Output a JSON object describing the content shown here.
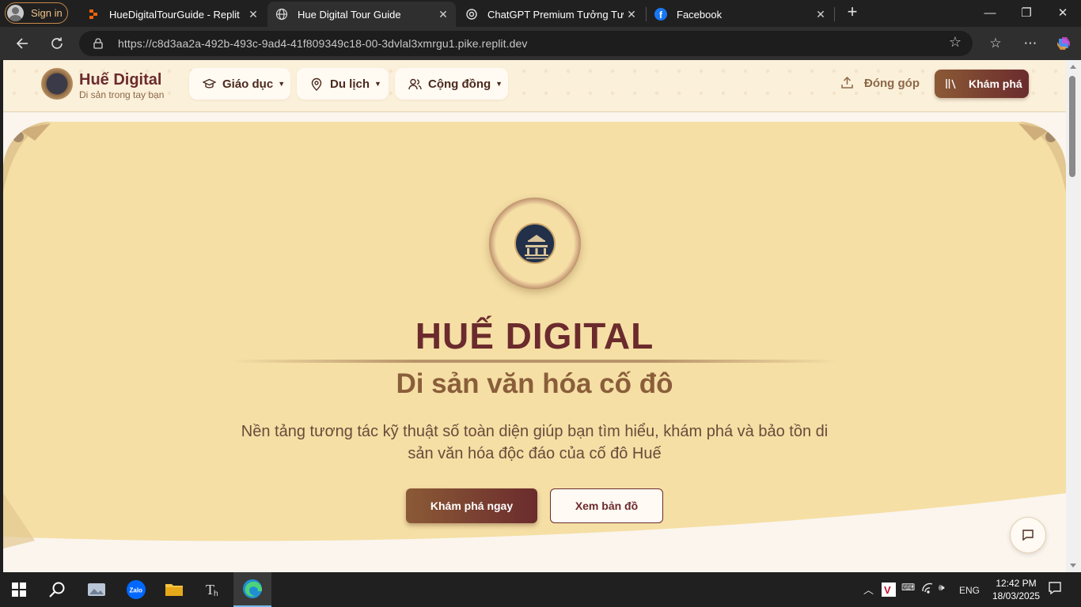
{
  "browser": {
    "signin_label": "Sign in",
    "tabs": [
      {
        "title": "HueDigitalTourGuide - Replit",
        "active": false
      },
      {
        "title": "Hue Digital Tour Guide",
        "active": true
      },
      {
        "title": "ChatGPT Premium Tưởng Tượng",
        "active": false
      },
      {
        "title": "Facebook",
        "active": false
      }
    ],
    "url": "https://c8d3aa2a-492b-493c-9ad4-41f809349c18-00-3dvlal3xmrgu1.pike.replit.dev"
  },
  "header": {
    "brand_title": "Huế Digital",
    "brand_subtitle": "Di sản trong tay bạn",
    "nav": [
      {
        "label": "Giáo dục",
        "icon": "graduation-cap-icon"
      },
      {
        "label": "Du lịch",
        "icon": "map-pin-icon"
      },
      {
        "label": "Cộng đồng",
        "icon": "users-icon"
      }
    ],
    "contribute_label": "Đóng góp",
    "explore_label": "Khám phá"
  },
  "hero": {
    "title": "HUẾ DIGITAL",
    "subtitle": "Di sản văn hóa cố đô",
    "description": "Nền tảng tương tác kỹ thuật số toàn diện giúp bạn tìm hiểu, khám phá và bảo tồn di sản văn hóa độc đáo của cố đô Huế",
    "primary_button": "Khám phá ngay",
    "secondary_button": "Xem bản đồ"
  },
  "taskbar": {
    "language": "ENG",
    "time": "12:42 PM",
    "date": "18/03/2025"
  },
  "colors": {
    "brand_maroon": "#6b2b2d",
    "hero_bg": "#f5dfa5",
    "accent_brown": "#8a5e3a"
  }
}
